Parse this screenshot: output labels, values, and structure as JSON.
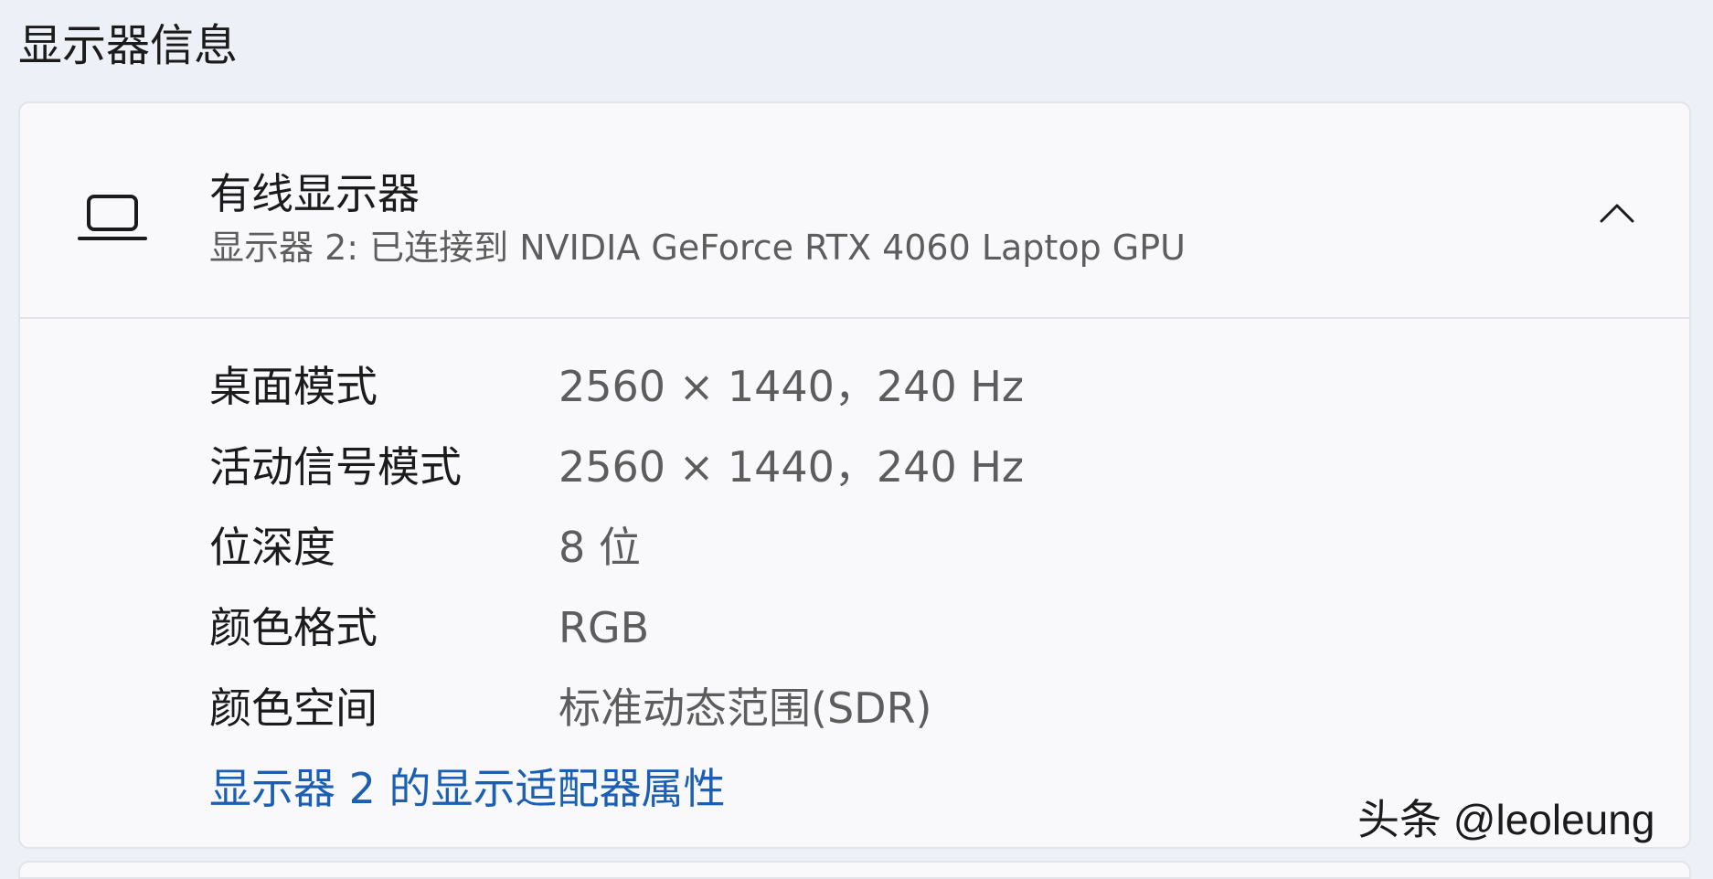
{
  "section_title": "显示器信息",
  "display": {
    "icon": "laptop-icon",
    "name": "有线显示器",
    "subtitle": "显示器 2: 已连接到 NVIDIA GeForce RTX 4060 Laptop GPU",
    "expanded": true,
    "toggle_icon": "chevron-up-icon",
    "details": [
      {
        "label": "桌面模式",
        "value": "2560 × 1440，240 Hz"
      },
      {
        "label": "活动信号模式",
        "value": "2560 × 1440，240 Hz"
      },
      {
        "label": "位深度",
        "value": "8 位"
      },
      {
        "label": "颜色格式",
        "value": "RGB"
      },
      {
        "label": "颜色空间",
        "value": "标准动态范围(SDR)"
      }
    ],
    "adapter_link": "显示器 2 的显示适配器属性"
  },
  "watermark": "头条 @leoleung",
  "colors": {
    "background": "#eef0f7",
    "card": "#f9f9fc",
    "link": "#1a5fb4",
    "text_primary": "#1b1b1b",
    "text_secondary": "#5d5d5d"
  }
}
